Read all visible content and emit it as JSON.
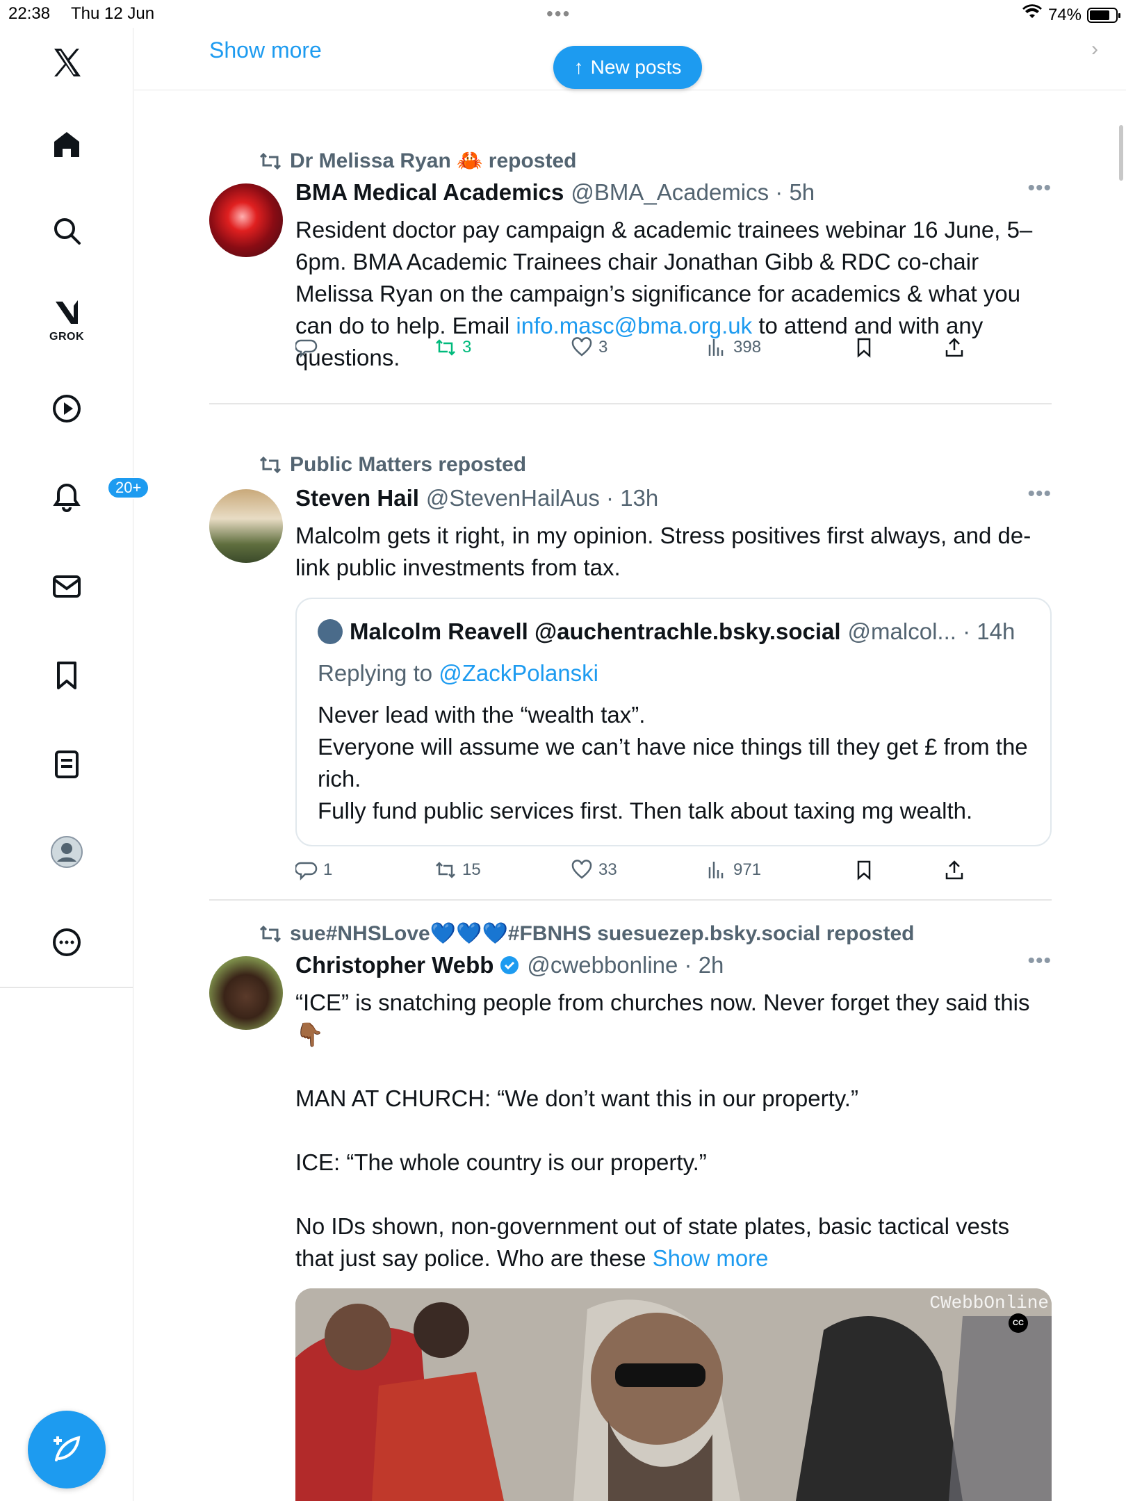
{
  "status_bar": {
    "time": "22:38",
    "date": "Thu 12 Jun",
    "wifi": "wifi-icon",
    "battery": "74%"
  },
  "sidebar": {
    "logo": "X",
    "items": [
      {
        "name": "home-icon"
      },
      {
        "name": "search-icon"
      },
      {
        "name": "grok-icon",
        "label": "GROK"
      },
      {
        "name": "play-icon"
      },
      {
        "name": "notifications-icon",
        "badge": "20+"
      },
      {
        "name": "messages-icon"
      },
      {
        "name": "bookmarks-icon"
      },
      {
        "name": "lists-icon"
      },
      {
        "name": "profile-icon"
      },
      {
        "name": "more-icon"
      }
    ],
    "compose": "compose-icon"
  },
  "top": {
    "show_more": "Show more",
    "new_posts": "New posts"
  },
  "tweets": [
    {
      "reposter": "Dr Melissa Ryan 🦀 reposted",
      "name": "BMA Medical Academics",
      "handle": "@BMA_Academics · 5h",
      "text_1": "Resident doctor pay campaign & academic trainees webinar 16 June, 5–6pm. BMA Academic Trainees chair Jonathan Gibb & RDC co-chair Melissa Ryan on the campaign’s significance for academics & what you can do to help. Email ",
      "link": "info.masc@bma.org.uk",
      "text_2": " to attend and with any questions.",
      "replies": "",
      "reposts": "3",
      "likes": "3",
      "views": "398"
    },
    {
      "reposter": "Public Matters reposted",
      "name": "Steven Hail",
      "handle": "@StevenHailAus · 13h",
      "text": "Malcolm gets it right, in my opinion. Stress positives first always, and de-link public investments from tax.",
      "quote": {
        "name": "Malcolm Reavell @auchentrachle.bsky.social",
        "handle": "@malcol... · 14h",
        "replying_prefix": "Replying to ",
        "replying_to": "@ZackPolanski",
        "line_1": "Never lead with the “wealth tax”.",
        "line_2": "Everyone will assume we can’t have nice things till they get £ from the rich.",
        "line_3": "Fully fund public services first. Then talk about taxing mg wealth."
      },
      "replies": "1",
      "reposts": "15",
      "likes": "33",
      "views": "971"
    },
    {
      "reposter": "sue#NHSLove💙💙💙#FBNHS suesuezep.bsky.social reposted",
      "name": "Christopher Webb",
      "handle": "@cwebbonline · 2h",
      "verified": "verified-badge-icon",
      "line_1": "“ICE” is snatching people from churches now. Never forget they said this 👇🏾",
      "line_2": "MAN AT CHURCH: “We don’t want this in our property.”",
      "line_3": "ICE: “The whole country is our property.”",
      "line_4": "No IDs shown, non-government out of state plates, basic tactical vests that just say police. Who are these ",
      "show_more": "Show more",
      "media_watermark": "CWebbOnline",
      "media_cc": "CC"
    }
  ],
  "colors": {
    "accent": "#1d9bf0",
    "muted": "#536471",
    "repost_active": "#00ba7c"
  }
}
